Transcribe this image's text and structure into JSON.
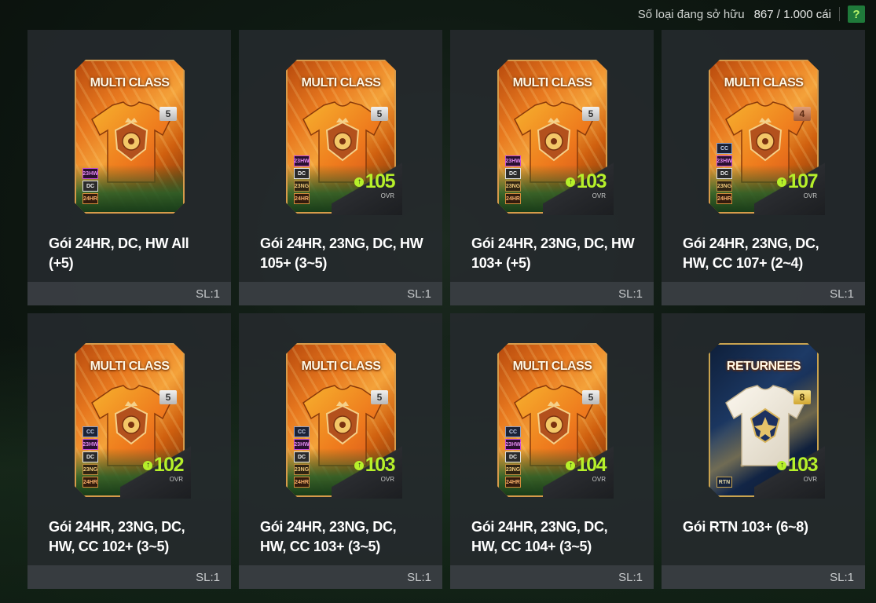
{
  "topbar": {
    "label": "Số loại đang sở hữu",
    "count": "867 / 1.000 cái",
    "help": "?"
  },
  "colors": {
    "accent": "#b6f02a",
    "help_bg": "#1f7a3a"
  },
  "packs": [
    {
      "card_title": "MULTI CLASS",
      "rank": "5",
      "rank_style": "silver",
      "badges": [
        "23HW",
        "DC",
        "24HR"
      ],
      "ovr": "",
      "ovr_label": "",
      "name": "Gói 24HR, DC, HW All (+5)",
      "qty": "SL:1"
    },
    {
      "card_title": "MULTI CLASS",
      "rank": "5",
      "rank_style": "silver",
      "badges": [
        "23HW",
        "DC",
        "23NG",
        "24HR"
      ],
      "ovr": "105",
      "ovr_label": "OVR",
      "name": "Gói 24HR, 23NG, DC, HW 105+ (3~5)",
      "qty": "SL:1"
    },
    {
      "card_title": "MULTI CLASS",
      "rank": "5",
      "rank_style": "silver",
      "badges": [
        "23HW",
        "DC",
        "23NG",
        "24HR"
      ],
      "ovr": "103",
      "ovr_label": "OVR",
      "name": "Gói 24HR, 23NG, DC, HW 103+ (+5)",
      "qty": "SL:1"
    },
    {
      "card_title": "MULTI CLASS",
      "rank": "4",
      "rank_style": "bronze",
      "badges": [
        "CC",
        "23HW",
        "DC",
        "23NG",
        "24HR"
      ],
      "ovr": "107",
      "ovr_label": "OVR",
      "name": "Gói 24HR, 23NG, DC, HW, CC 107+ (2~4)",
      "qty": "SL:1"
    },
    {
      "card_title": "MULTI CLASS",
      "rank": "5",
      "rank_style": "silver",
      "badges": [
        "CC",
        "23HW",
        "DC",
        "23NG",
        "24HR"
      ],
      "ovr": "102",
      "ovr_label": "OVR",
      "name": "Gói 24HR, 23NG, DC, HW, CC 102+ (3~5)",
      "qty": "SL:1"
    },
    {
      "card_title": "MULTI CLASS",
      "rank": "5",
      "rank_style": "silver",
      "badges": [
        "CC",
        "23HW",
        "DC",
        "23NG",
        "24HR"
      ],
      "ovr": "103",
      "ovr_label": "OVR",
      "name": "Gói 24HR, 23NG, DC, HW, CC 103+ (3~5)",
      "qty": "SL:1"
    },
    {
      "card_title": "MULTI CLASS",
      "rank": "5",
      "rank_style": "silver",
      "badges": [
        "CC",
        "23HW",
        "DC",
        "23NG",
        "24HR"
      ],
      "ovr": "104",
      "ovr_label": "OVR",
      "name": "Gói 24HR, 23NG, DC, HW, CC 104+ (3~5)",
      "qty": "SL:1"
    },
    {
      "card_title": "RETURNEES",
      "rank": "8",
      "rank_style": "gold",
      "badges": [
        "RTN"
      ],
      "ovr": "103",
      "ovr_label": "OVR",
      "name": "Gói RTN 103+ (6~8)",
      "qty": "SL:1"
    }
  ]
}
